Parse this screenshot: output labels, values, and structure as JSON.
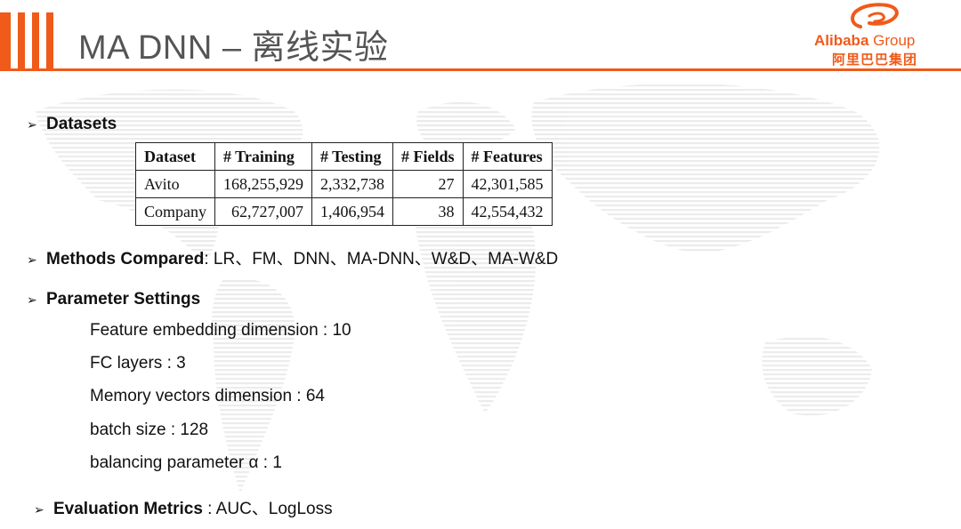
{
  "header": {
    "title": "MA DNN – 离线实验",
    "logo_en_main": "Alibaba",
    "logo_en_group": " Group",
    "logo_cn": "阿里巴巴集团"
  },
  "sections": {
    "datasets_label": "Datasets",
    "methods_label": "Methods Compared",
    "methods_value": ": LR、FM、DNN、MA-DNN、W&D、MA-W&D",
    "params_label": "Parameter Settings",
    "params": [
      "Feature embedding dimension : 10",
      "FC layers : 3",
      "Memory vectors dimension : 64",
      "batch size : 128",
      "balancing parameter α : 1"
    ],
    "metrics_label": "Evaluation Metrics",
    "metrics_value": " : AUC、LogLoss"
  },
  "table": {
    "headers": [
      "Dataset",
      "# Training",
      "# Testing",
      "# Fields",
      "# Features"
    ],
    "rows": [
      [
        "Avito",
        "168,255,929",
        "2,332,738",
        "27",
        "42,301,585"
      ],
      [
        "Company",
        "62,727,007",
        "1,406,954",
        "38",
        "42,554,432"
      ]
    ]
  },
  "colors": {
    "accent": "#f05a1a"
  },
  "icons": [
    "bullet-arrow-icon",
    "alibaba-logo-icon"
  ]
}
